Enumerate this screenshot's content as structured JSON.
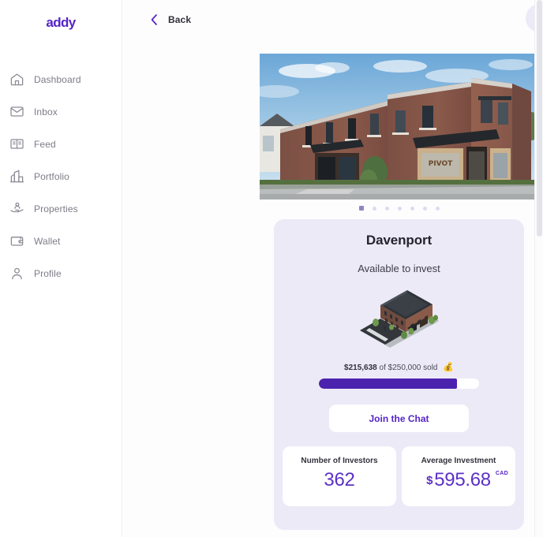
{
  "brand": {
    "name": "addy"
  },
  "sidebar": {
    "items": [
      {
        "label": "Dashboard",
        "icon": "home-icon"
      },
      {
        "label": "Inbox",
        "icon": "envelope-icon"
      },
      {
        "label": "Feed",
        "icon": "book-icon"
      },
      {
        "label": "Portfolio",
        "icon": "bar-chart-icon"
      },
      {
        "label": "Properties",
        "icon": "hand-person-icon"
      },
      {
        "label": "Wallet",
        "icon": "wallet-icon"
      },
      {
        "label": "Profile",
        "icon": "person-icon"
      }
    ]
  },
  "topbar": {
    "back_label": "Back"
  },
  "carousel": {
    "dot_count": 7,
    "active_index": 0,
    "image_alt": "Davenport brick building exterior rendering"
  },
  "property": {
    "title": "Davenport",
    "status": "Available to invest",
    "illustration_alt": "Isometric building illustration",
    "funding": {
      "raised": "$215,638",
      "of_text": "of",
      "goal": "$250,000",
      "sold_text": "sold",
      "emoji": "💰",
      "percent": 86
    },
    "chat_button_label": "Join the Chat",
    "stats": [
      {
        "label": "Number of Investors",
        "value": "362",
        "currency_symbol": "",
        "badge": ""
      },
      {
        "label": "Average Investment",
        "value": "595.68",
        "currency_symbol": "$",
        "badge": "CAD"
      }
    ]
  },
  "colors": {
    "brand_purple": "#5524c6",
    "progress_fill": "#4b22ae",
    "card_bg": "#eceaf7",
    "value_purple": "#5c30c8"
  }
}
